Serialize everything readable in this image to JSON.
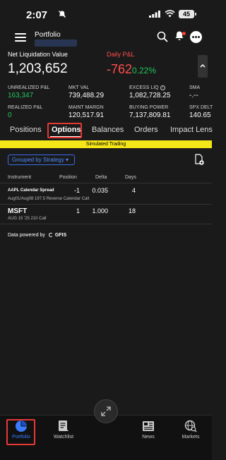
{
  "status": {
    "time": "2:07",
    "battery": "45"
  },
  "header": {
    "title": "Portfolio"
  },
  "summary": {
    "net_liq_label": "Net Liquidation Value",
    "net_liq_value": "1,203,652",
    "daily_pl_label": "Daily P&L",
    "daily_pl_value": "-762",
    "daily_pl_pct": "0.22%"
  },
  "metrics": [
    {
      "label": "UNREALIZED P&L",
      "value": "163,347",
      "green": true
    },
    {
      "label": "MKT VAL",
      "value": "739,488.29"
    },
    {
      "label": "EXCESS LIQ",
      "value": "1,082,728.25",
      "info": true
    },
    {
      "label": "SMA",
      "value": "-.--"
    },
    {
      "label": "REALIZED P&L",
      "value": "0",
      "green": true
    },
    {
      "label": "MAINT MARGN",
      "value": "120,517.91"
    },
    {
      "label": "BUYING POWER",
      "value": "7,137,809.81"
    },
    {
      "label": "SPX DELT",
      "value": "140.65"
    }
  ],
  "tabs": [
    "Positions",
    "Options",
    "Balances",
    "Orders",
    "Impact Lens"
  ],
  "banner": "Simulated Trading",
  "group_button": "Grouped by Strategy ▾",
  "table": {
    "headers": {
      "instrument": "Instrument",
      "position": "Position",
      "delta": "Delta",
      "days": "Days"
    },
    "rows": [
      {
        "symbol": "AAPL Calendar Spread",
        "desc": "Aug01/Aug08 197.5 Reverse Calendar Call",
        "position": "-1",
        "delta": "0.035",
        "days": "4"
      },
      {
        "symbol": "MSFT",
        "desc": "AUG 15 '25 210 Call",
        "position": "1",
        "delta": "1.000",
        "days": "18"
      }
    ]
  },
  "powered_by": {
    "text": "Data powered by",
    "brand": "GFIS"
  },
  "nav": {
    "portfolio": "Portfolio",
    "watchlist": "Watchlist",
    "news": "News",
    "markets": "Markets"
  },
  "colors": {
    "accent": "#3a7bff",
    "negative": "#ff4d4d",
    "positive": "#22c55e",
    "banner": "#f5e61a",
    "highlight": "#e53935"
  }
}
